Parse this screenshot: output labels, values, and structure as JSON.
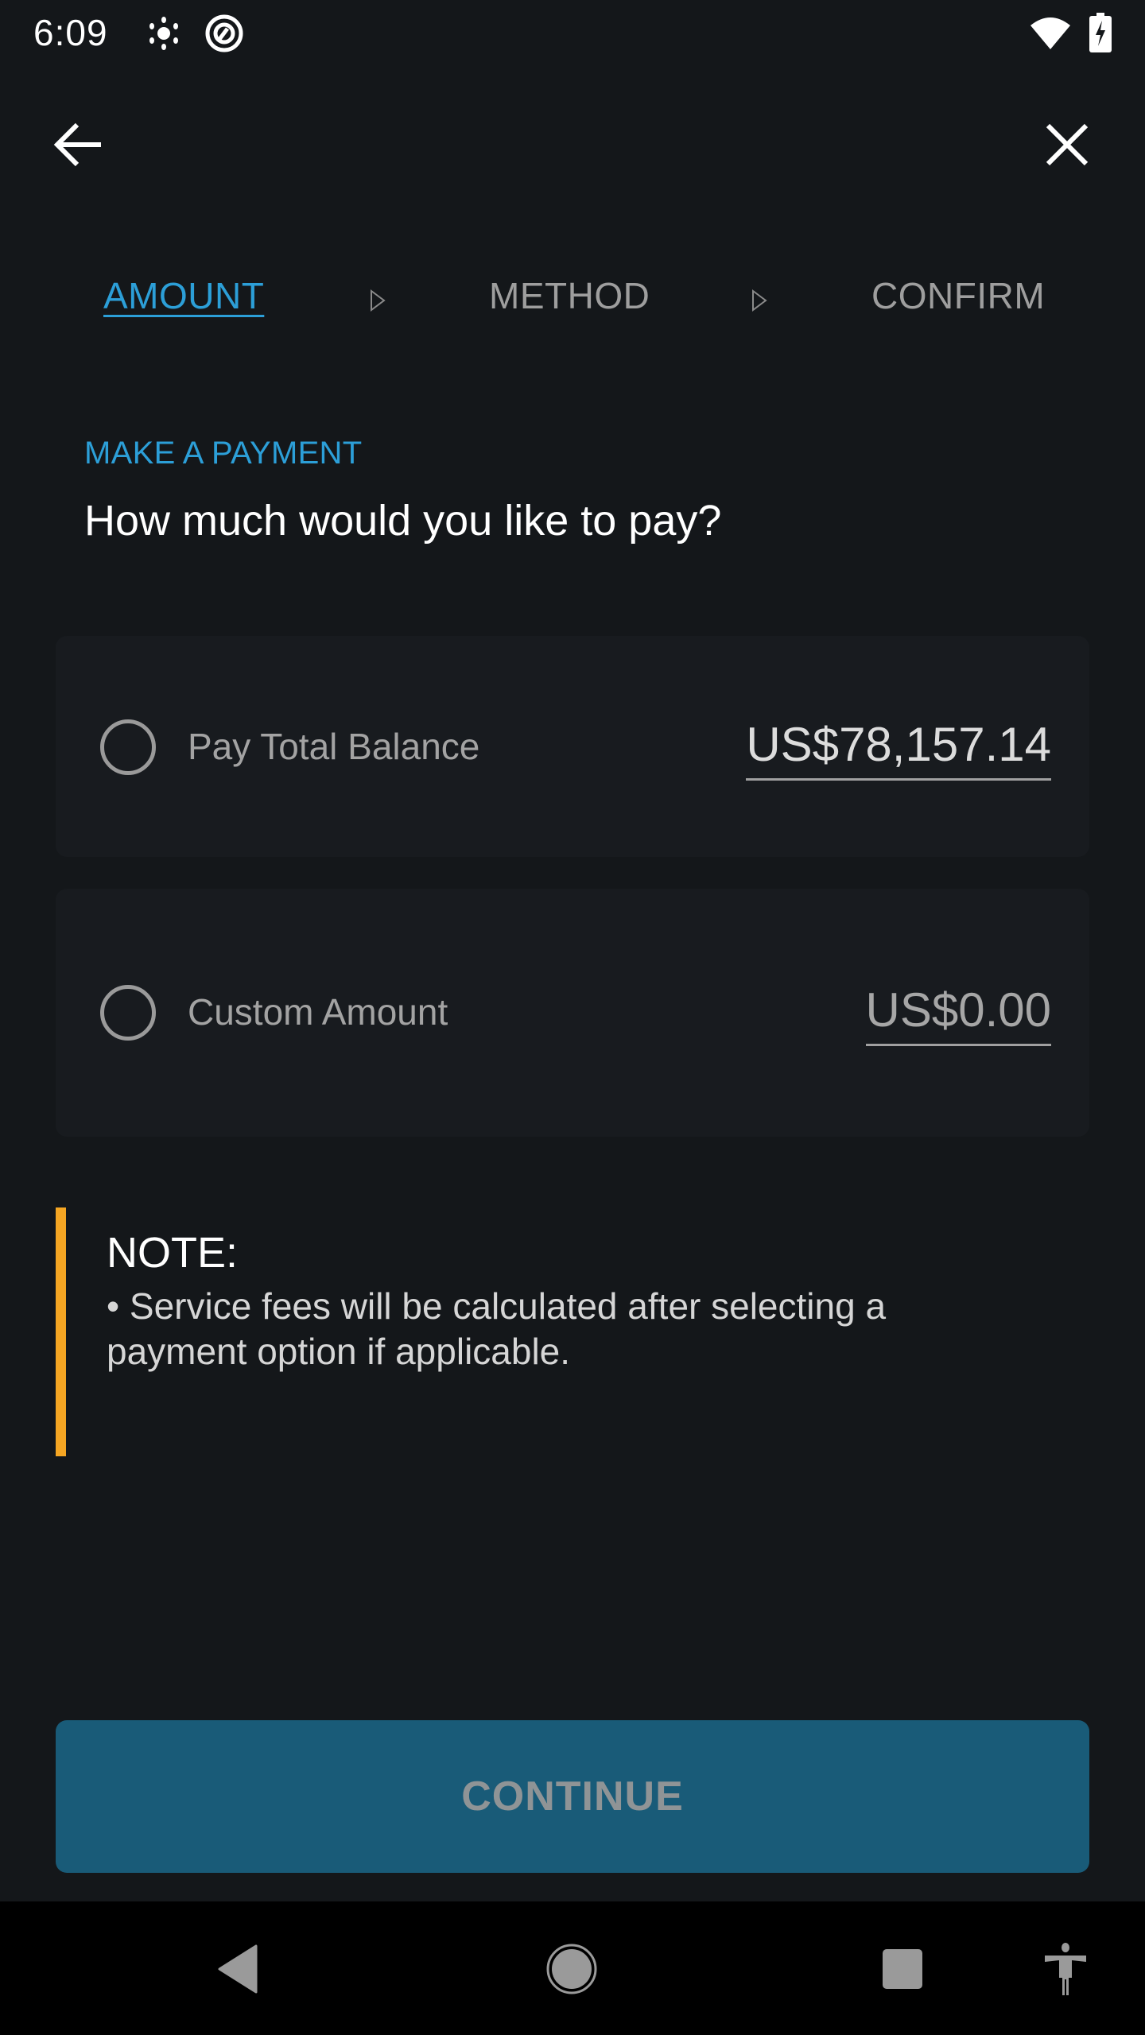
{
  "status_bar": {
    "time": "6:09",
    "icons": [
      "brightness-icon",
      "app-notification-icon",
      "wifi-icon",
      "battery-charging-icon"
    ]
  },
  "header": {
    "back_icon": "arrow-left-icon",
    "close_icon": "close-icon"
  },
  "stepper": {
    "steps": [
      {
        "label": "AMOUNT",
        "active": true
      },
      {
        "label": "METHOD",
        "active": false
      },
      {
        "label": "CONFIRM",
        "active": false
      }
    ],
    "separator_icon": "triangle-right-outline-icon"
  },
  "main": {
    "eyebrow": "MAKE A PAYMENT",
    "question": "How much would you like to pay?",
    "options": [
      {
        "label": "Pay Total Balance",
        "amount": "US$78,157.14",
        "selected": false
      },
      {
        "label": "Custom Amount",
        "amount": "US$0.00",
        "selected": false
      }
    ]
  },
  "note": {
    "title": "NOTE:",
    "body": "• Service fees will be calculated after selecting a payment option if applicable."
  },
  "actions": {
    "continue_label": "CONTINUE",
    "continue_enabled": false
  },
  "colors": {
    "accent": "#2c9fd8",
    "note_bar": "#f5a623",
    "button_bg": "#195b78",
    "background": "#14171a"
  },
  "nav_bar": {
    "icons": [
      "nav-back-icon",
      "nav-home-icon",
      "nav-recents-icon",
      "accessibility-icon"
    ]
  }
}
